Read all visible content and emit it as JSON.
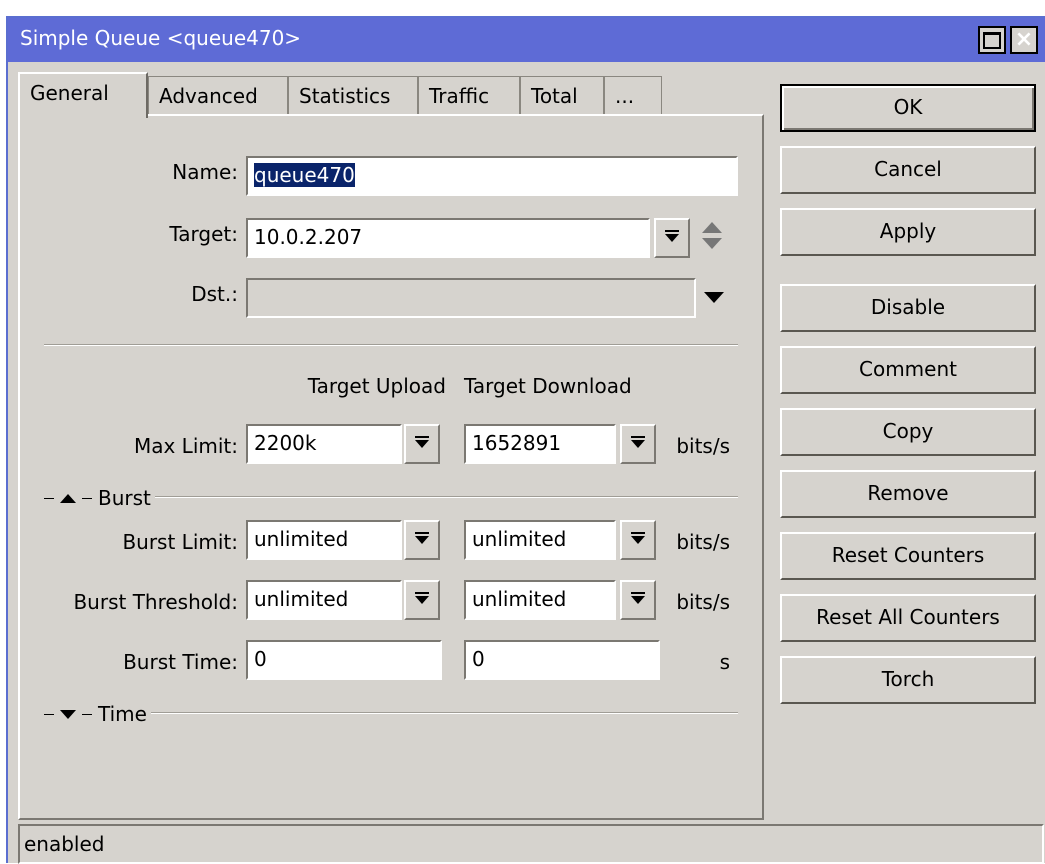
{
  "window": {
    "title": "Simple Queue <queue470>"
  },
  "tabs": [
    "General",
    "Advanced",
    "Statistics",
    "Traffic",
    "Total",
    "..."
  ],
  "general": {
    "name_label": "Name:",
    "name_value": "queue470",
    "target_label": "Target:",
    "target_value": "10.0.2.207",
    "dst_label": "Dst.:",
    "dst_value": "",
    "col_upload": "Target Upload",
    "col_download": "Target Download",
    "max_limit_label": "Max Limit:",
    "max_limit_upload": "2200k",
    "max_limit_download": "1652891",
    "unit_bits": "bits/s",
    "burst_group": "Burst",
    "burst_limit_label": "Burst Limit:",
    "burst_limit_upload": "unlimited",
    "burst_limit_download": "unlimited",
    "burst_threshold_label": "Burst Threshold:",
    "burst_threshold_upload": "unlimited",
    "burst_threshold_download": "unlimited",
    "burst_time_label": "Burst Time:",
    "burst_time_upload": "0",
    "burst_time_download": "0",
    "unit_s": "s",
    "time_group": "Time"
  },
  "buttons": {
    "ok": "OK",
    "cancel": "Cancel",
    "apply": "Apply",
    "disable": "Disable",
    "comment": "Comment",
    "copy": "Copy",
    "remove": "Remove",
    "reset_counters": "Reset Counters",
    "reset_all_counters": "Reset All Counters",
    "torch": "Torch"
  },
  "status": "enabled"
}
